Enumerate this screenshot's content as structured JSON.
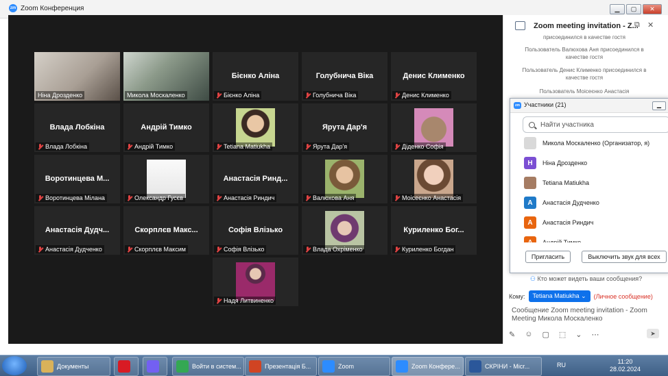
{
  "window": {
    "title": "Zoom Конференция",
    "min": "▁",
    "max": "▢",
    "close": "✕"
  },
  "tiles": [
    {
      "name": "Ніна Дрозденко",
      "big": ""
    },
    {
      "name": "Микола Москаленко",
      "big": ""
    },
    {
      "name": "Бієнко Аліна",
      "big": "Бієнко Аліна"
    },
    {
      "name": "Голубнича Віка",
      "big": "Голубнича Віка"
    },
    {
      "name": "Денис Клименко",
      "big": "Денис Клименко"
    },
    {
      "name": "Влада Лобкіна",
      "big": "Влада Лобкіна"
    },
    {
      "name": "Андрій Тимко",
      "big": "Андрій Тимко"
    },
    {
      "name": "Tetiana Matiukha",
      "big": ""
    },
    {
      "name": "Ярута Дар'я",
      "big": "Ярута Дар'я"
    },
    {
      "name": "Діденко Софія",
      "big": ""
    },
    {
      "name": "Воротинцева Мілана",
      "big": "Воротинцева М..."
    },
    {
      "name": "Олександр Гусєв",
      "big": ""
    },
    {
      "name": "Анастасія Риндич",
      "big": "Анастасія Ринд..."
    },
    {
      "name": "Валюхова Аня",
      "big": ""
    },
    {
      "name": "Моісеєнко Анастасія",
      "big": ""
    },
    {
      "name": "Анастасія Дудченко",
      "big": "Анастасія Дудч..."
    },
    {
      "name": "Скорплєв Максим",
      "big": "Скорплєв Макс..."
    },
    {
      "name": "Софія Влізько",
      "big": "Софія Влізько"
    },
    {
      "name": "Влада Охріменко",
      "big": ""
    },
    {
      "name": "Куриленко Богдан",
      "big": "Куриленко Бог..."
    },
    {
      "name": "Надя Литвиненко",
      "big": ""
    }
  ],
  "chat": {
    "title": "Zoom meeting invitation - Z...",
    "messages": [
      "присоединился в качестве гостя",
      "Пользователь Валюхова Аня присоединился в качестве гостя",
      "Пользователь Денис Клименко присоединился в качестве гостя",
      "Пользователь Моісеєнко Анастасія"
    ],
    "who_sees": "Кто может видеть ваши сообщения?",
    "to_label": "Кому:",
    "to_value": "Tetiana Matiukha",
    "private_label": "(Личное сообщение)",
    "compose_text": "Сообщение Zoom meeting invitation - Zoom Meeting Микола Москаленко"
  },
  "participants": {
    "title": "Участники (21)",
    "search_placeholder": "Найти участника",
    "list": [
      {
        "name": "Микола Москаленко (Организатор, я)",
        "initial": "",
        "color": "#d9d9d9"
      },
      {
        "name": "Ніна Дрозденко",
        "initial": "Н",
        "color": "#7b4fd3"
      },
      {
        "name": "Tetiana Matiukha",
        "initial": "",
        "color": "#a57c63"
      },
      {
        "name": "Анастасія Дудченко",
        "initial": "А",
        "color": "#1f7ac8"
      },
      {
        "name": "Анастасія Риндич",
        "initial": "А",
        "color": "#e8650f"
      },
      {
        "name": "Андрій Тимко",
        "initial": "А",
        "color": "#e8650f"
      }
    ],
    "invite_label": "Пригласить",
    "mute_all_label": "Выключить звук для всех"
  },
  "taskbar": {
    "items": [
      {
        "label": "Документы",
        "icon": "folder-icon",
        "color": "#d9b25a"
      },
      {
        "label": "",
        "icon": "opera-icon",
        "color": "#d81b24"
      },
      {
        "label": "",
        "icon": "viber-icon",
        "color": "#7360f2"
      },
      {
        "label": "Войти в систем...",
        "icon": "chrome-icon",
        "color": "#34a853"
      },
      {
        "label": "Презентація Б...",
        "icon": "powerpoint-icon",
        "color": "#d04423"
      },
      {
        "label": "Zoom",
        "icon": "zoom-icon",
        "color": "#2d8cff"
      },
      {
        "label": "Zoom Конфере...",
        "icon": "zoom-icon",
        "color": "#2d8cff"
      },
      {
        "label": "СКРІНИ - Micr...",
        "icon": "word-icon",
        "color": "#2b579a"
      }
    ],
    "lang": "RU",
    "time": "11:20",
    "date": "28.02.2024"
  }
}
